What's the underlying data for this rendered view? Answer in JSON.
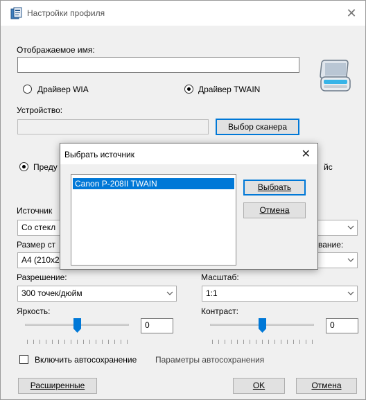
{
  "window": {
    "title": "Настройки профиля",
    "close_label": "✕"
  },
  "display_name": {
    "label": "Отображаемое имя:",
    "value": ""
  },
  "driver": {
    "wia_label": "Драйвер WIA",
    "twain_label": "Драйвер TWAIN",
    "selected": "twain"
  },
  "device": {
    "label": "Устройство:",
    "value": "",
    "select_scanner_label": "Выбор сканера"
  },
  "source_section": {
    "radio_left_partial": "Преду",
    "radio_right_partial": "йс",
    "source_label_partial": "Источник",
    "source_value_partial": "Со стекл",
    "page_size_label_partial": "Размер ст",
    "page_size_value_partial": "A4 (210x2",
    "right_label_partial": "вание:"
  },
  "resolution": {
    "label": "Разрешение:",
    "value": "300 точек/дюйм"
  },
  "scale": {
    "label": "Масштаб:",
    "value": "1:1"
  },
  "brightness": {
    "label": "Яркость:",
    "value": "0",
    "level": 0.5
  },
  "contrast": {
    "label": "Контраст:",
    "value": "0",
    "level": 0.5
  },
  "autosave": {
    "checkbox_label": "Включить автосохранение",
    "settings_link": "Параметры автосохранения",
    "checked": false
  },
  "footer": {
    "advanced_label": "Расширенные",
    "ok_label": "OK",
    "cancel_label": "Отмена"
  },
  "source_dialog": {
    "title": "Выбрать источник",
    "close_label": "✕",
    "items": [
      "Canon P-208II TWAIN"
    ],
    "selected_index": 0,
    "select_label": "Выбрать",
    "cancel_label": "Отмена"
  },
  "colors": {
    "accent": "#0078d7",
    "window_bg": "#f0f0f0"
  }
}
